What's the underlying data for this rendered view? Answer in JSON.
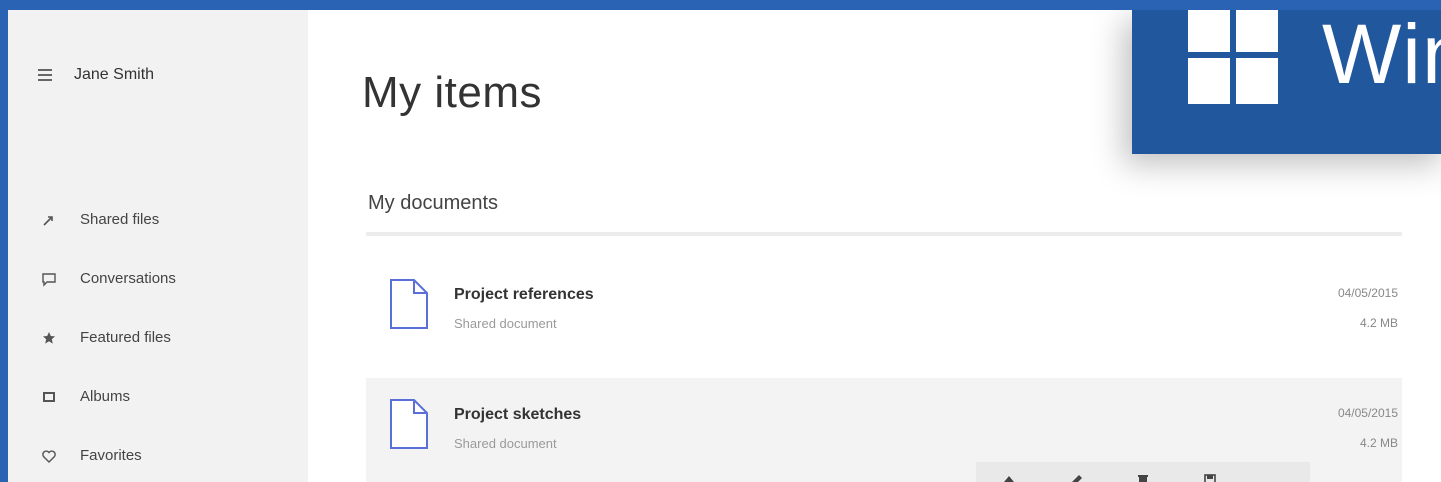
{
  "sidebar": {
    "user_name": "Jane Smith",
    "items": [
      {
        "icon": "share-icon",
        "label": "Shared files"
      },
      {
        "icon": "chat-icon",
        "label": "Conversations"
      },
      {
        "icon": "star-icon",
        "label": "Featured files"
      },
      {
        "icon": "album-icon",
        "label": "Albums"
      },
      {
        "icon": "heart-icon",
        "label": "Favorites"
      }
    ]
  },
  "main": {
    "title": "My items",
    "section_title": "My documents",
    "documents": [
      {
        "name": "Project references",
        "subtitle": "Shared document",
        "date": "04/05/2015",
        "size": "4.2 MB"
      },
      {
        "name": "Project sketches",
        "subtitle": "Shared document",
        "date": "04/05/2015",
        "size": "4.2 MB"
      }
    ]
  },
  "banner": {
    "text": "Win",
    "color": "#21579d"
  },
  "command_bar": {
    "buttons": [
      "upload-icon",
      "edit-icon",
      "delete-icon",
      "save-icon",
      "more-icon"
    ]
  },
  "colors": {
    "accent": "#2a62b4",
    "doc_icon": "#5b6fd8"
  }
}
